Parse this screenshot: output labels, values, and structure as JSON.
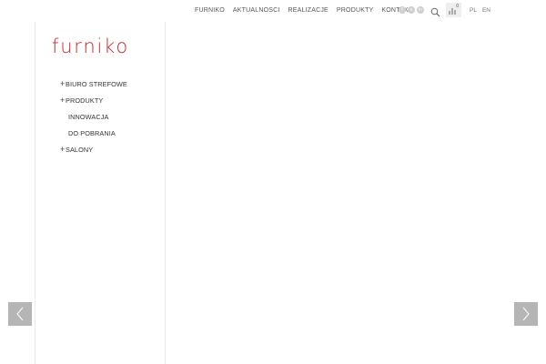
{
  "nav": {
    "items": [
      "FURNIKO",
      "AKTUALNOSCI",
      "REALIZACJE",
      "PRODUKTY",
      "KONTAKT"
    ]
  },
  "social": [
    {
      "icon": "facebook-icon",
      "glyph": "f"
    },
    {
      "icon": "vimeo-icon",
      "glyph": "v"
    },
    {
      "icon": "linkedin-icon",
      "glyph": "in"
    }
  ],
  "cart": {
    "count": "0"
  },
  "lang": [
    "PL",
    "EN"
  ],
  "logo": {
    "text": "furniko",
    "color": "#c1272d"
  },
  "sidebar": {
    "items": [
      {
        "label": "BIURO STREFOWE",
        "expandable": true
      },
      {
        "label": "PRODUKTY",
        "expandable": true
      },
      {
        "label": "INNOWACJA",
        "expandable": false
      },
      {
        "label": "DO POBRANIA",
        "expandable": false
      },
      {
        "label": "SALONY",
        "expandable": true
      }
    ]
  },
  "colors": {
    "accent": "#c1272d",
    "arrow_bg": "#b5b5b5",
    "divider": "#eaeaea"
  }
}
